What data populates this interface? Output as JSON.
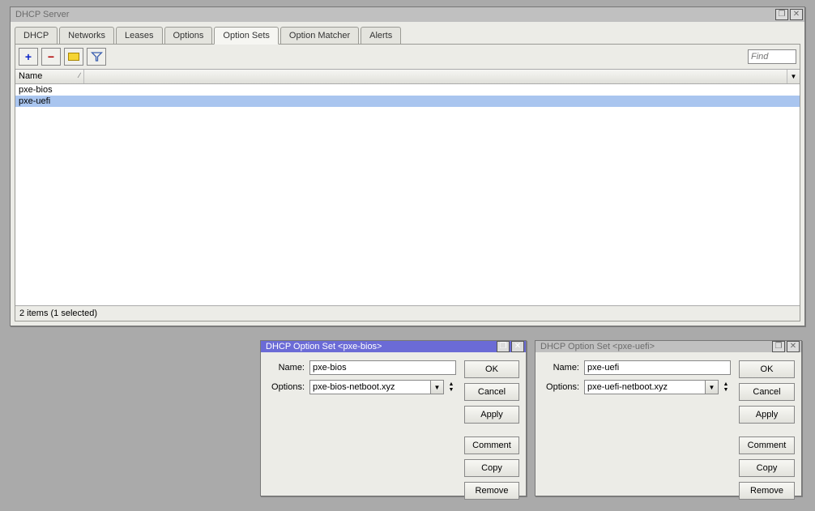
{
  "main_window": {
    "title": "DHCP Server",
    "tabs": [
      "DHCP",
      "Networks",
      "Leases",
      "Options",
      "Option Sets",
      "Option Matcher",
      "Alerts"
    ],
    "active_tab_index": 4,
    "find_placeholder": "Find",
    "grid": {
      "columns": [
        "Name"
      ],
      "rows": [
        "pxe-bios",
        "pxe-uefi"
      ],
      "selected_index": 1
    },
    "status": "2 items (1 selected)"
  },
  "dialog_buttons": {
    "ok": "OK",
    "cancel": "Cancel",
    "apply": "Apply",
    "comment": "Comment",
    "copy": "Copy",
    "remove": "Remove"
  },
  "form_labels": {
    "name": "Name:",
    "options": "Options:"
  },
  "dialog1": {
    "active": true,
    "title": "DHCP Option Set <pxe-bios>",
    "name_value": "pxe-bios",
    "options_value": "pxe-bios-netboot.xyz"
  },
  "dialog2": {
    "active": false,
    "title": "DHCP Option Set <pxe-uefi>",
    "name_value": "pxe-uefi",
    "options_value": "pxe-uefi-netboot.xyz"
  }
}
